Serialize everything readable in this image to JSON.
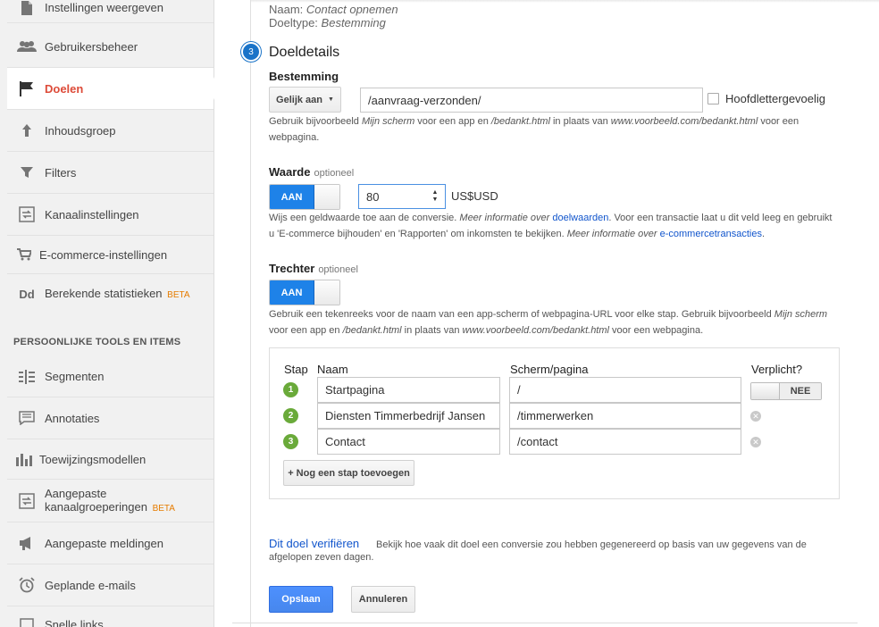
{
  "sidebar": {
    "items": [
      {
        "label": "Instellingen weergeven",
        "icon": "document-icon"
      },
      {
        "label": "Gebruikersbeheer",
        "icon": "users-icon"
      },
      {
        "label": "Doelen",
        "icon": "flag-icon"
      },
      {
        "label": "Inhoudsgroep",
        "icon": "content-grouping-icon"
      },
      {
        "label": "Filters",
        "icon": "filter-icon"
      },
      {
        "label": "Kanaalinstellingen",
        "icon": "channel-settings-icon"
      },
      {
        "label": "E-commerce-instellingen",
        "icon": "cart-icon"
      },
      {
        "label": "Berekende statistieken",
        "beta": "BETA",
        "icon": "calculated-metrics-icon"
      }
    ],
    "section_title": "PERSOONLIJKE TOOLS EN ITEMS",
    "personal_items": [
      {
        "label": "Segmenten",
        "icon": "segments-icon"
      },
      {
        "label": "Annotaties",
        "icon": "annotations-icon"
      },
      {
        "label": "Toewijzingsmodellen",
        "icon": "attribution-icon"
      },
      {
        "label": "Aangepaste",
        "label2": "kanaalgroeperingen",
        "beta": "BETA",
        "icon": "channel-grouping-icon"
      },
      {
        "label": "Aangepaste meldingen",
        "icon": "megaphone-icon"
      },
      {
        "label": "Geplande e-mails",
        "icon": "alarm-clock-icon"
      },
      {
        "label": "Snelle links",
        "icon": "quick-links-icon"
      }
    ]
  },
  "summary": {
    "name_label": "Naam:",
    "name_value": "Contact opnemen",
    "type_label": "Doeltype:",
    "type_value": "Bestemming"
  },
  "details": {
    "step_number": "3",
    "title": "Doeldetails",
    "destination": {
      "label": "Bestemming",
      "match_type": "Gelijk aan",
      "value": "/aanvraag-verzonden/",
      "case_sensitive_label": "Hoofdlettergevoelig",
      "help_1": "Gebruik bijvoorbeeld ",
      "help_2": "Mijn scherm",
      "help_3": " voor een app en ",
      "help_4": "/bedankt.html",
      "help_5": " in plaats van ",
      "help_6": "www.voorbeeld.com/bedankt.html",
      "help_7": " voor een",
      "help_8": "webpagina."
    },
    "value": {
      "label": "Waarde",
      "optional": "optioneel",
      "toggle": "AAN",
      "amount": "80",
      "currency": "US$USD",
      "help_1": "Wijs een geldwaarde toe aan de conversie. ",
      "help_2": "Meer informatie over ",
      "help_link": "doelwaarden",
      "help_3": ". Voor een transactie laat u dit veld leeg en gebruikt",
      "help_4": "u 'E-commerce bijhouden' en 'Rapporten' om inkomsten te bekijken. ",
      "help_5": "Meer informatie over ",
      "help_link2": "e-commercetransacties",
      "help_6": "."
    },
    "funnel": {
      "label": "Trechter",
      "optional": "optioneel",
      "toggle": "AAN",
      "help_1": "Gebruik een tekenreeks voor de naam van een app-scherm of webpagina-URL voor elke stap. Gebruik bijvoorbeeld ",
      "help_2": "Mijn scherm",
      "help_3": "voor een app en ",
      "help_4": "/bedankt.html",
      "help_5": " in plaats van ",
      "help_6": "www.voorbeeld.com/bedankt.html",
      "help_7": " voor een webpagina.",
      "headers": {
        "step": "Stap",
        "name": "Naam",
        "screen": "Scherm/pagina",
        "required": "Verplicht?"
      },
      "rows": [
        {
          "step": "1",
          "name": "Startpagina",
          "screen": "/"
        },
        {
          "step": "2",
          "name": "Diensten Timmerbedrijf Jansen",
          "screen": "/timmerwerken"
        },
        {
          "step": "3",
          "name": "Contact",
          "screen": "/contact"
        }
      ],
      "required_toggle": "NEE",
      "add_step": "+ Nog een stap toevoegen"
    }
  },
  "verify": {
    "link": "Dit doel verifiëren",
    "text_1": "Bekijk hoe vaak dit doel een conversie zou hebben gegenereerd op basis van uw gegevens van de",
    "text_2": "afgelopen zeven dagen."
  },
  "actions": {
    "save": "Opslaan",
    "cancel": "Annuleren"
  },
  "colors": {
    "accent": "#1a73c8",
    "active_nav": "#dd4b39",
    "toggle_on": "#1e82e8",
    "step_badge": "#6aaa3a",
    "beta": "#e67c00"
  }
}
